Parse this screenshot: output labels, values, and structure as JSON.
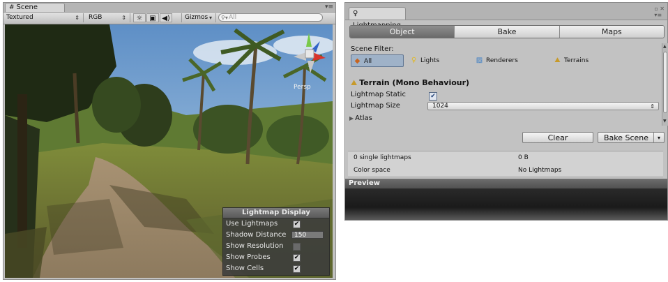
{
  "scene": {
    "tab_label": "Scene",
    "toolbar": {
      "render_mode": "Textured",
      "color_mode": "RGB",
      "gizmos_label": "Gizmos",
      "search_placeholder": "All"
    },
    "persp_label": "Persp",
    "lightmap_display": {
      "title": "Lightmap Display",
      "rows": [
        {
          "label": "Use Lightmaps",
          "checked": true
        },
        {
          "label": "Shadow Distance",
          "value": "150"
        },
        {
          "label": "Show Resolution",
          "checked": false
        },
        {
          "label": "Show Probes",
          "checked": true
        },
        {
          "label": "Show Cells",
          "checked": true
        }
      ]
    }
  },
  "lightmapping": {
    "tab_label": "Lightmapping",
    "segments": [
      "Object",
      "Bake",
      "Maps"
    ],
    "active_segment": "Object",
    "scene_filter": {
      "label": "Scene Filter:",
      "options": [
        "All",
        "Lights",
        "Renderers",
        "Terrains"
      ],
      "active": "All"
    },
    "component_title": "Terrain (Mono Behaviour)",
    "properties": {
      "lightmap_static_label": "Lightmap Static",
      "lightmap_static_checked": true,
      "lightmap_size_label": "Lightmap Size",
      "lightmap_size_value": "1024",
      "atlas_label": "Atlas"
    },
    "buttons": {
      "clear": "Clear",
      "bake_scene": "Bake Scene"
    },
    "info": {
      "lightmaps_label": "0 single lightmaps",
      "lightmaps_value": "0 B",
      "color_space_label": "Color space",
      "color_space_value": "No Lightmaps"
    },
    "preview_label": "Preview"
  }
}
